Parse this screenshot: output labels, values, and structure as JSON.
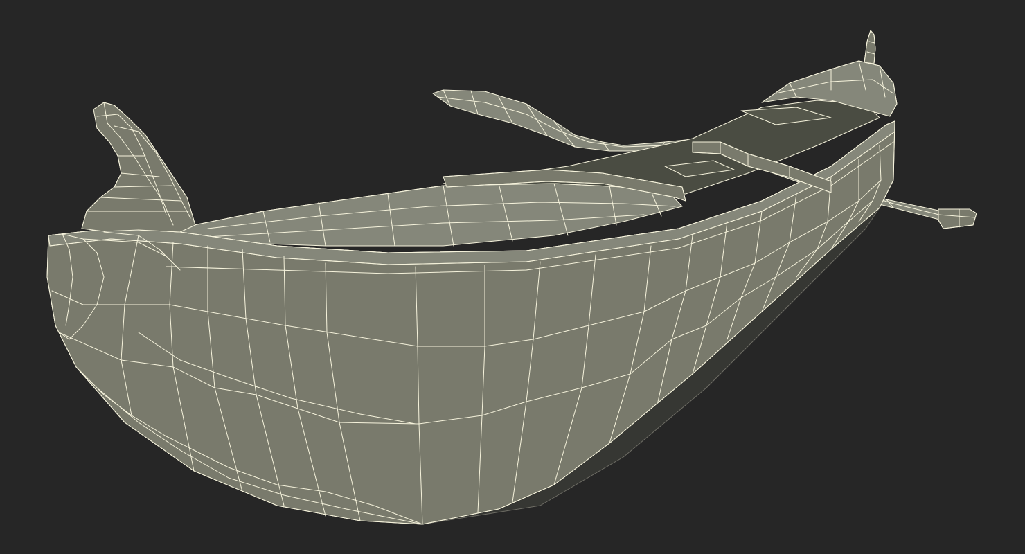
{
  "scene": {
    "subject": "gondola-boat-3d-wireframe",
    "render_mode": "wireframe-on-shaded",
    "colors": {
      "background": "#262626",
      "surface": "#797a6c",
      "surface_light": "#85877a",
      "surface_dark": "#55574b",
      "interior": "#4a4c42",
      "wire": "#f6f3dc"
    }
  }
}
